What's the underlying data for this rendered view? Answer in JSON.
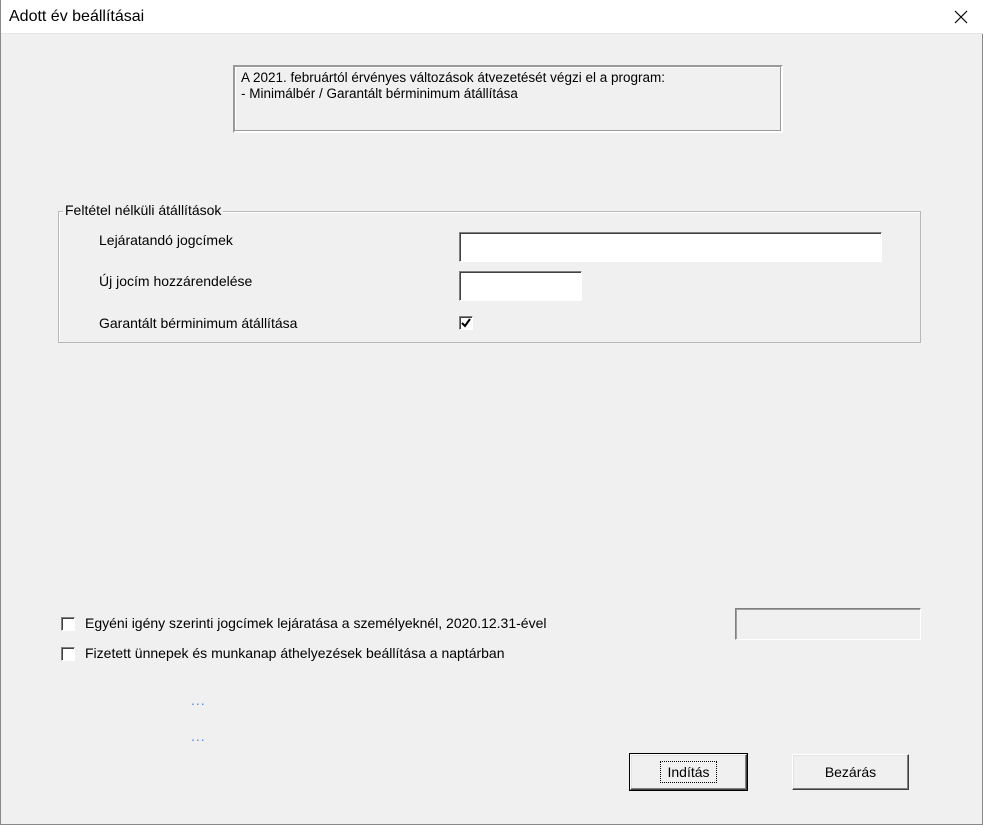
{
  "window": {
    "title": "Adott év beállításai"
  },
  "info": {
    "line1": "A 2021. februártól érvényes változások átvezetését végzi el a program:",
    "line2": "- Minimálbér / Garantált bérminimum átállítása"
  },
  "group": {
    "legend": "Feltétel nélküli átállítások",
    "expire_label": "Lejáratandó jogcímek",
    "expire_value": "",
    "new_label": "Új jocím hozzárendelése",
    "new_value": "",
    "guaranteed_label": "Garantált bérminimum átállítása",
    "guaranteed_checked": true
  },
  "options": {
    "individual_label": "Egyéni igény szerinti jogcímek lejáratása a személyeknél, 2020.12.31-ével",
    "individual_checked": false,
    "individual_value": "",
    "holidays_label": "Fizetett ünnepek és munkanap áthelyezések beállítása a naptárban",
    "holidays_checked": false
  },
  "dots": {
    "d1": "...",
    "d2": "..."
  },
  "buttons": {
    "start_label": "Indítás",
    "close_label": "Bezárás"
  },
  "icons": {
    "close": "close-icon",
    "check": "checkmark-icon"
  }
}
